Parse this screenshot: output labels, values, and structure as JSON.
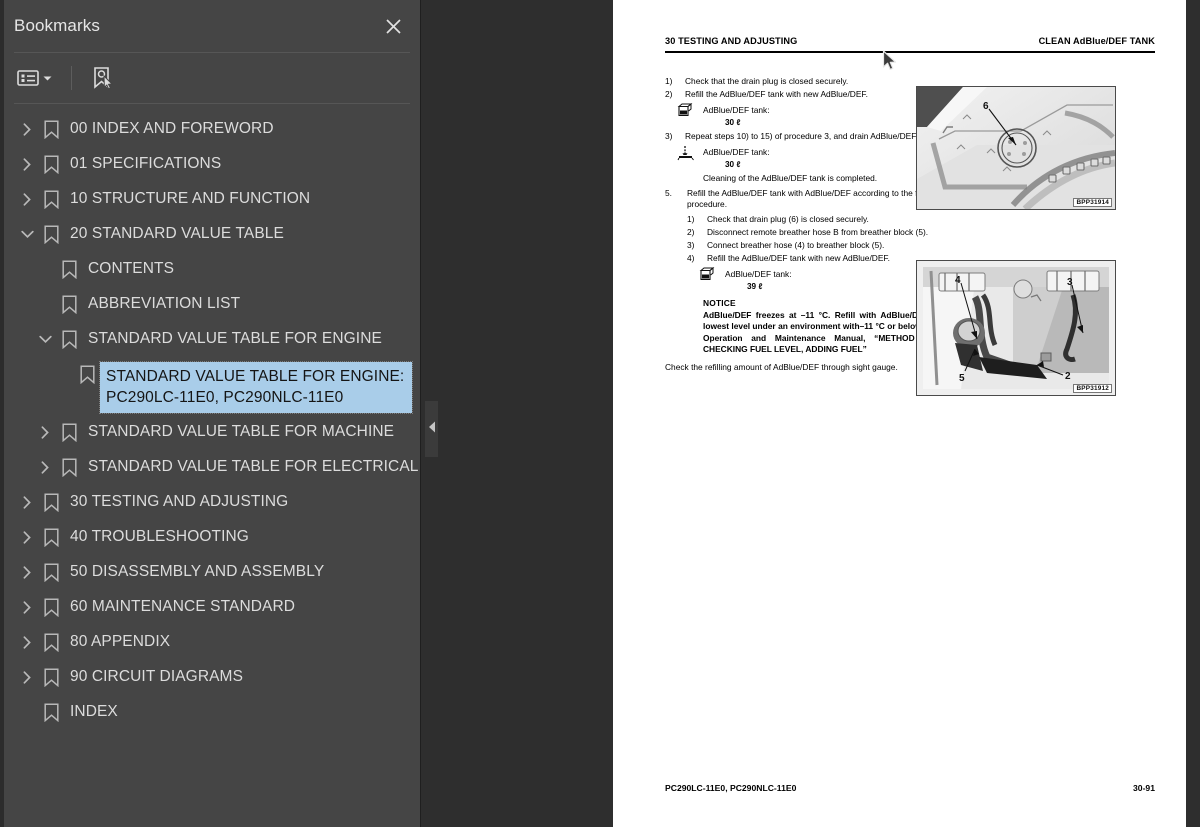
{
  "panel": {
    "title": "Bookmarks",
    "close_icon": "close-icon",
    "toolbar": {
      "list_options_icon": "list-options-icon",
      "dropdown_icon": "chevron-down-icon",
      "find_bookmark_icon": "bookmark-pointer-icon"
    },
    "collapse_icon": "chevron-left-icon",
    "selected_color": "#a9cde9",
    "background_color": "#454545"
  },
  "bookmarks": [
    {
      "label": "00 INDEX AND FOREWORD",
      "level": 0,
      "state": "collapsed",
      "selected": false
    },
    {
      "label": "01 SPECIFICATIONS",
      "level": 0,
      "state": "collapsed",
      "selected": false
    },
    {
      "label": "10 STRUCTURE AND FUNCTION",
      "level": 0,
      "state": "collapsed",
      "selected": false
    },
    {
      "label": "20 STANDARD VALUE TABLE",
      "level": 0,
      "state": "expanded",
      "selected": false
    },
    {
      "label": "CONTENTS",
      "level": 1,
      "state": "leaf",
      "selected": false
    },
    {
      "label": "ABBREVIATION LIST",
      "level": 1,
      "state": "leaf",
      "selected": false
    },
    {
      "label": "STANDARD VALUE TABLE FOR ENGINE",
      "level": 1,
      "state": "expanded",
      "selected": false
    },
    {
      "label": "STANDARD VALUE TABLE FOR ENGINE: PC290LC-11E0, PC290NLC-11E0",
      "level": 2,
      "state": "leaf",
      "selected": true
    },
    {
      "label": "STANDARD VALUE TABLE FOR MACHINE",
      "level": 1,
      "state": "collapsed",
      "selected": false
    },
    {
      "label": "STANDARD VALUE TABLE FOR ELECTRICAL",
      "level": 1,
      "state": "collapsed",
      "selected": false
    },
    {
      "label": "30 TESTING AND ADJUSTING",
      "level": 0,
      "state": "collapsed",
      "selected": false
    },
    {
      "label": "40 TROUBLESHOOTING",
      "level": 0,
      "state": "collapsed",
      "selected": false
    },
    {
      "label": "50 DISASSEMBLY AND ASSEMBLY",
      "level": 0,
      "state": "collapsed",
      "selected": false
    },
    {
      "label": "60 MAINTENANCE STANDARD",
      "level": 0,
      "state": "collapsed",
      "selected": false
    },
    {
      "label": "80 APPENDIX",
      "level": 0,
      "state": "collapsed",
      "selected": false
    },
    {
      "label": "90 CIRCUIT DIAGRAMS",
      "level": 0,
      "state": "collapsed",
      "selected": false
    },
    {
      "label": "INDEX",
      "level": 0,
      "state": "leaf",
      "selected": false
    }
  ],
  "document": {
    "header_left": "30 TESTING AND ADJUSTING",
    "header_right": "CLEAN AdBlue/DEF TANK",
    "footer_left": "PC290LC-11E0, PC290NLC-11E0",
    "footer_right": "30-91",
    "steps_top": [
      {
        "num": "1)",
        "text": "Check that the drain plug is closed securely."
      },
      {
        "num": "2)",
        "text": "Refill the AdBlue/DEF tank with new AdBlue/DEF."
      }
    ],
    "spec_1": {
      "label": "AdBlue/DEF tank:",
      "value": "30 ℓ",
      "icon": "refill-container-icon"
    },
    "step_3": {
      "num": "3)",
      "text": "Repeat steps 10) to 15) of procedure 3, and drain AdBlue/DEF."
    },
    "spec_2": {
      "label": "AdBlue/DEF tank:",
      "value": "30 ℓ",
      "icon": "drain-level-icon"
    },
    "completed_line": "Cleaning of the AdBlue/DEF tank is completed.",
    "section_5": {
      "num": "5.",
      "text": "Refill the AdBlue/DEF tank with AdBlue/DEF according to the following procedure.",
      "substeps": [
        {
          "num": "1)",
          "text": "Check that drain plug (6) is closed securely."
        },
        {
          "num": "2)",
          "text": "Disconnect remote breather hose B from breather block (5)."
        },
        {
          "num": "3)",
          "text": "Connect breather hose (4) to breather block (5)."
        },
        {
          "num": "4)",
          "text": "Refill the AdBlue/DEF tank with new AdBlue/DEF."
        }
      ]
    },
    "spec_3": {
      "label": "AdBlue/DEF tank:",
      "value": "39 ℓ",
      "icon": "refill-container-icon"
    },
    "notice": {
      "title": "NOTICE",
      "text": "AdBlue/DEF freezes at –11 °C. Refill with AdBlue/DEF to lowest level under an environment with–11 °C or below. See Operation and Maintenance Manual, “METHOD FOR CHECKING FUEL LEVEL, ADDING FUEL”"
    },
    "final_line": "Check the refilling amount of AdBlue/DEF through sight gauge.",
    "figures": [
      {
        "id": "BPP31914",
        "callouts": [
          "6"
        ],
        "caption_name": "drain-plug-figure"
      },
      {
        "id": "BPP31912",
        "callouts": [
          "2",
          "3",
          "4",
          "5"
        ],
        "caption_name": "breather-block-figure"
      }
    ]
  }
}
